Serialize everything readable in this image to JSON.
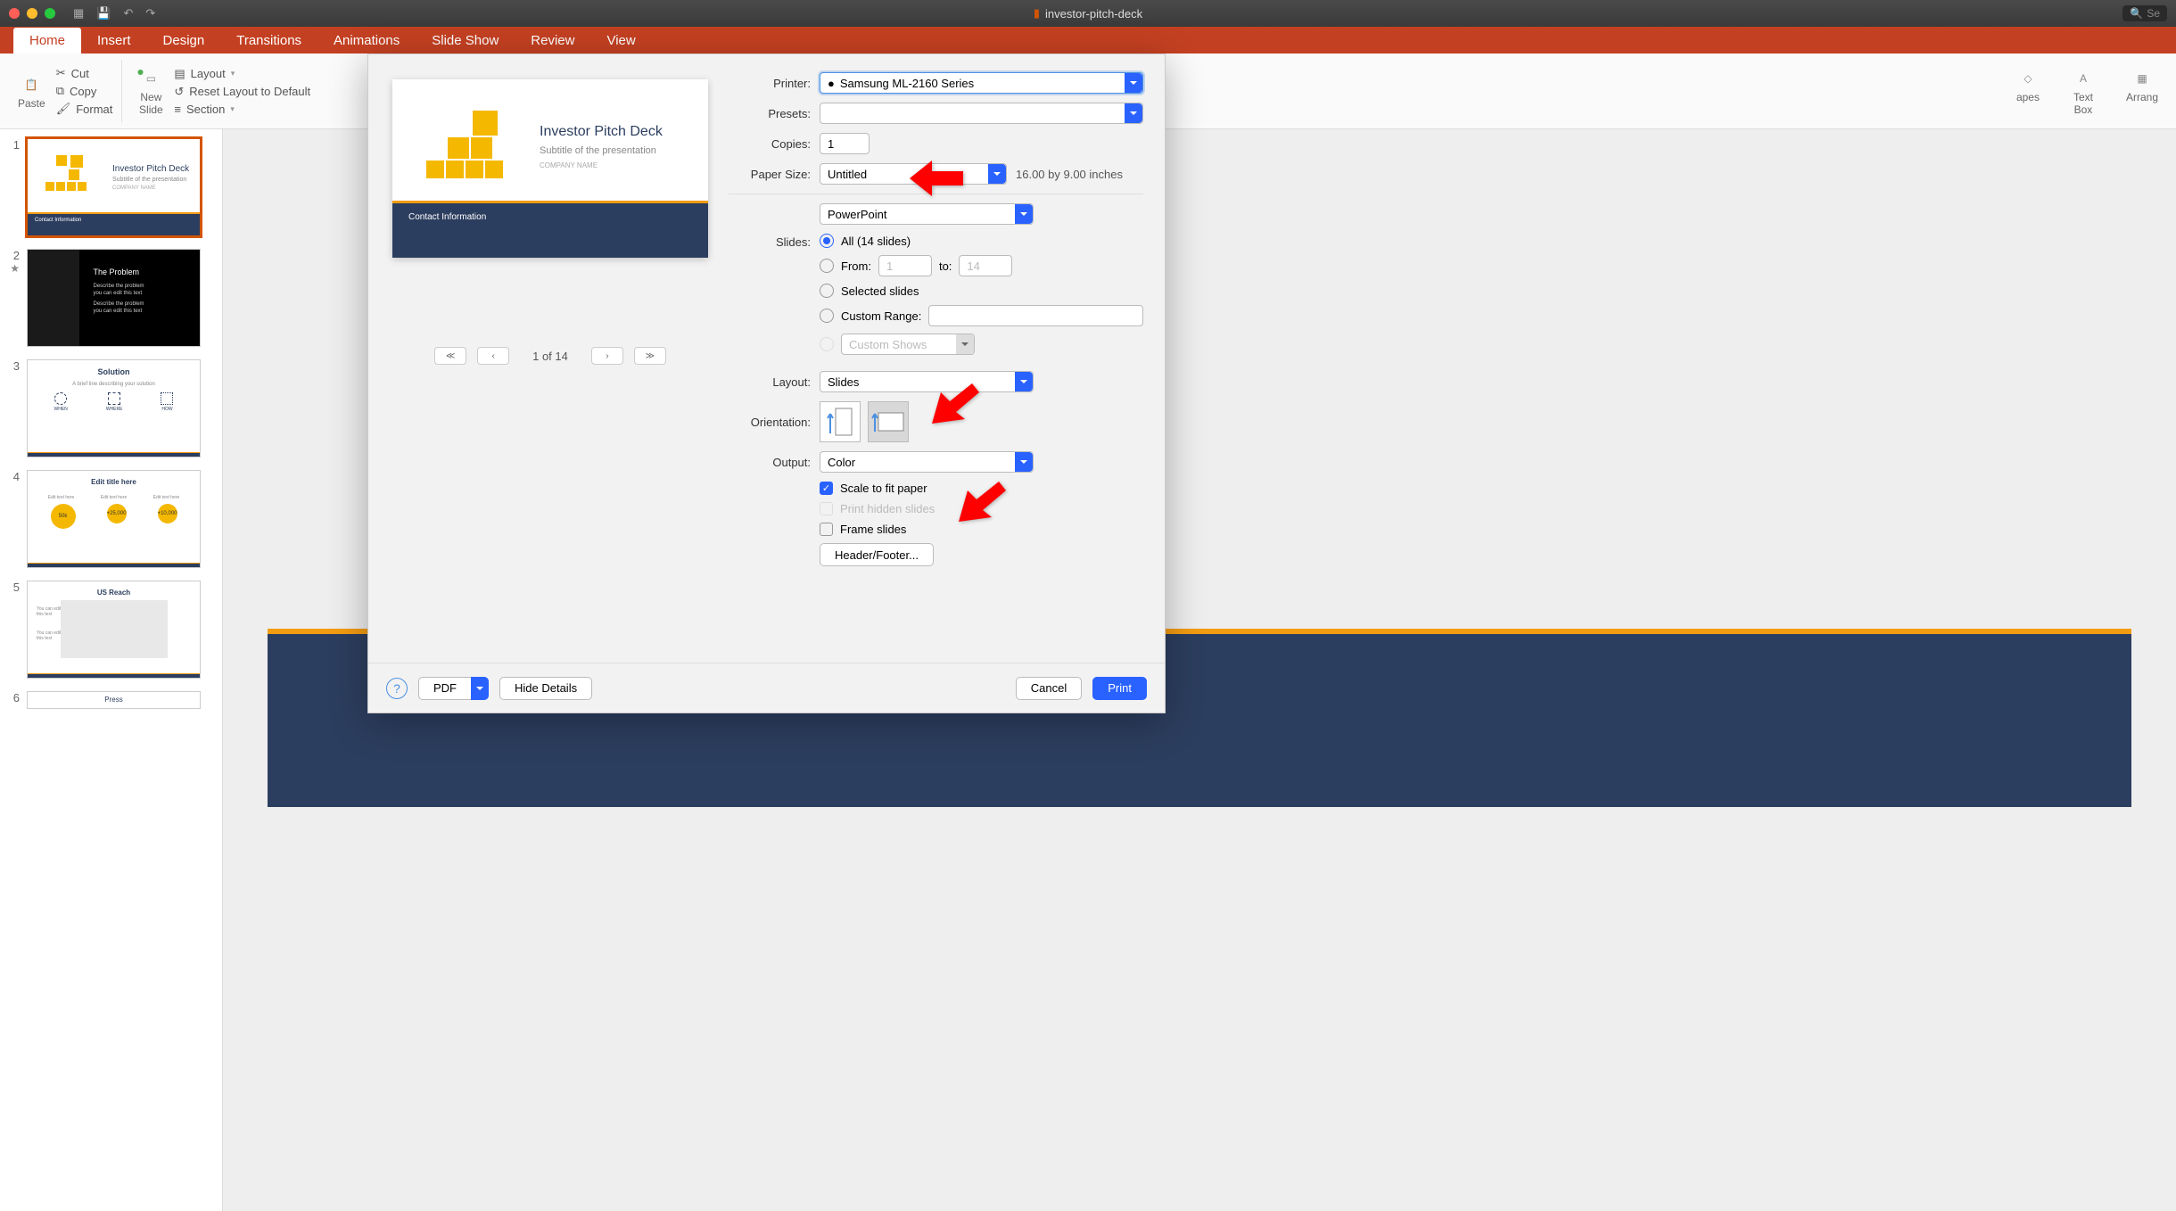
{
  "titlebar": {
    "filename": "investor-pitch-deck",
    "search_placeholder": "Se"
  },
  "tabs": [
    "Home",
    "Insert",
    "Design",
    "Transitions",
    "Animations",
    "Slide Show",
    "Review",
    "View"
  ],
  "active_tab": 0,
  "ribbon": {
    "paste": "Paste",
    "cut": "Cut",
    "copy": "Copy",
    "format": "Format",
    "new_slide": "New\nSlide",
    "layout": "Layout",
    "reset_layout": "Reset Layout to Default",
    "section": "Section",
    "shapes": "apes",
    "text_box": "Text\nBox",
    "arrange": "Arrang"
  },
  "thumbs": [
    {
      "num": "1",
      "type": "title",
      "title": "Investor Pitch Deck",
      "sub": "Subtitle of the presentation",
      "sub2": "COMPANY NAME",
      "footer": "Contact Information",
      "selected": true
    },
    {
      "num": "2",
      "type": "problem",
      "title": "The Problem",
      "lines": [
        "Describe the problem",
        "you can edit this text",
        "Describe the problem",
        "you can edit this text"
      ],
      "starred": true
    },
    {
      "num": "3",
      "type": "solution",
      "title": "Solution",
      "sub": "A brief line describing your solution",
      "items": [
        "WHEN",
        "WHERE",
        "HOW"
      ]
    },
    {
      "num": "4",
      "type": "circles",
      "title": "Edit title here",
      "labels": [
        "Edit text here",
        "Edit text here",
        "Edit text here"
      ],
      "values": [
        "50k",
        "+25,000",
        "+10,000"
      ]
    },
    {
      "num": "5",
      "type": "map",
      "title": "US Reach",
      "txt": [
        "You can edit",
        "this text",
        "You can edit",
        "this text"
      ]
    },
    {
      "num": "6",
      "type": "plain",
      "title": "Press"
    }
  ],
  "dialog": {
    "printer_label": "Printer:",
    "printer_value": "Samsung ML-2160 Series",
    "presets_label": "Presets:",
    "presets_value": "",
    "copies_label": "Copies:",
    "copies_value": "1",
    "paper_size_label": "Paper Size:",
    "paper_size_value": "Untitled",
    "paper_size_info": "16.00 by 9.00 inches",
    "app_menu_value": "PowerPoint",
    "slides_label": "Slides:",
    "all_label": "All  (14 slides)",
    "from_label": "From:",
    "from_value": "1",
    "to_label": "to:",
    "to_value": "14",
    "selected_label": "Selected slides",
    "custom_range_label": "Custom Range:",
    "custom_shows_label": "Custom Shows",
    "layout_label": "Layout:",
    "layout_value": "Slides",
    "orientation_label": "Orientation:",
    "output_label": "Output:",
    "output_value": "Color",
    "scale_label": "Scale to fit paper",
    "hidden_label": "Print hidden slides",
    "frame_label": "Frame slides",
    "header_footer_label": "Header/Footer...",
    "pager_text": "1 of 14",
    "help": "?",
    "pdf_label": "PDF",
    "hide_details": "Hide Details",
    "cancel": "Cancel",
    "print": "Print",
    "preview": {
      "title": "Investor Pitch Deck",
      "sub": "Subtitle of the presentation",
      "sub2": "COMPANY NAME",
      "footer": "Contact Information"
    }
  }
}
